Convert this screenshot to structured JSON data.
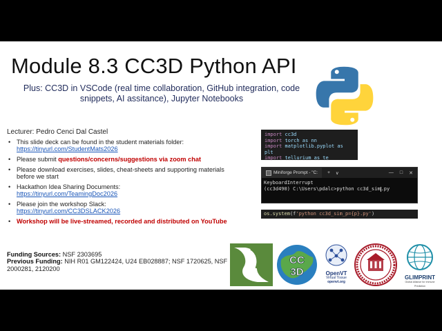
{
  "slide": {
    "title": "Module 8.3 CC3D Python API",
    "subtitle": "Plus: CC3D in VSCode (real time collaboration, GitHub integration, code snippets, AI assitance), Jupyter Notebooks",
    "lecturer": "Lecturer: Pedro Cenci Dal Castel",
    "bullets": [
      {
        "text": "This slide deck can be found in the student materials folder:",
        "link": "https://tinyurl.com/StudentMats2026"
      },
      {
        "text": "Please submit ",
        "red": "questions/concerns/suggestions via zoom chat"
      },
      {
        "text": "Please download exercises, slides, cheat-sheets and supporting materials before we start"
      },
      {
        "text": "Hackathon Idea Sharing Documents:",
        "link": "https://tinyurl.com/TeamingDoc2026"
      },
      {
        "text": "Please join the workshop Slack:",
        "link": "https://tinyurl.com/CC3DSLACK2026"
      },
      {
        "red": "Workshop will be live-streamed, recorded and distributed on YouTube"
      }
    ],
    "funding_label": "Funding Sources:",
    "funding_value": " NSF 2303695",
    "prev_funding_label": "Previous Funding:",
    "prev_funding_value": " NIH R01 GM122424, U24 EB028887; NSF 1720625, NSF 2000281, 2120200"
  },
  "code_snippet": {
    "lines": [
      {
        "kw": "import",
        "mod": " cc3d"
      },
      {
        "kw": "import",
        "mod": " torch as nn"
      },
      {
        "kw": "import",
        "mod": " matplotlib.pyplot as plt"
      },
      {
        "kw": "import",
        "mod": " tellurium as te"
      }
    ]
  },
  "terminal": {
    "tab_title": "Miniforge Prompt - \"C:",
    "new_tab": "+",
    "dropdown": "∨",
    "minimize": "—",
    "maximize": "□",
    "close": "✕",
    "line1": "KeyboardInterrupt",
    "line2": "(cc3d490) C:\\Users\\pdalc>python cc3d_sim",
    "line2_end": ".py"
  },
  "os_call": {
    "fn": "os.system",
    "open": "(f",
    "str": "'python cc3d_sim_p={p}.py'",
    "close": ")"
  },
  "logos": {
    "cc3d": "CC\n3D",
    "openvt_name": "OpenVT",
    "openvt_sub": "Virtual Tissue",
    "openvt_url": "openvt.org",
    "glimprint": "GLIMPRINT",
    "glimprint_sub": "Global Alliance for Immune Prediction"
  },
  "colors": {
    "red": "#c00000",
    "link": "#1a56b8",
    "python_blue": "#3776ab",
    "python_yellow": "#ffd43b"
  }
}
